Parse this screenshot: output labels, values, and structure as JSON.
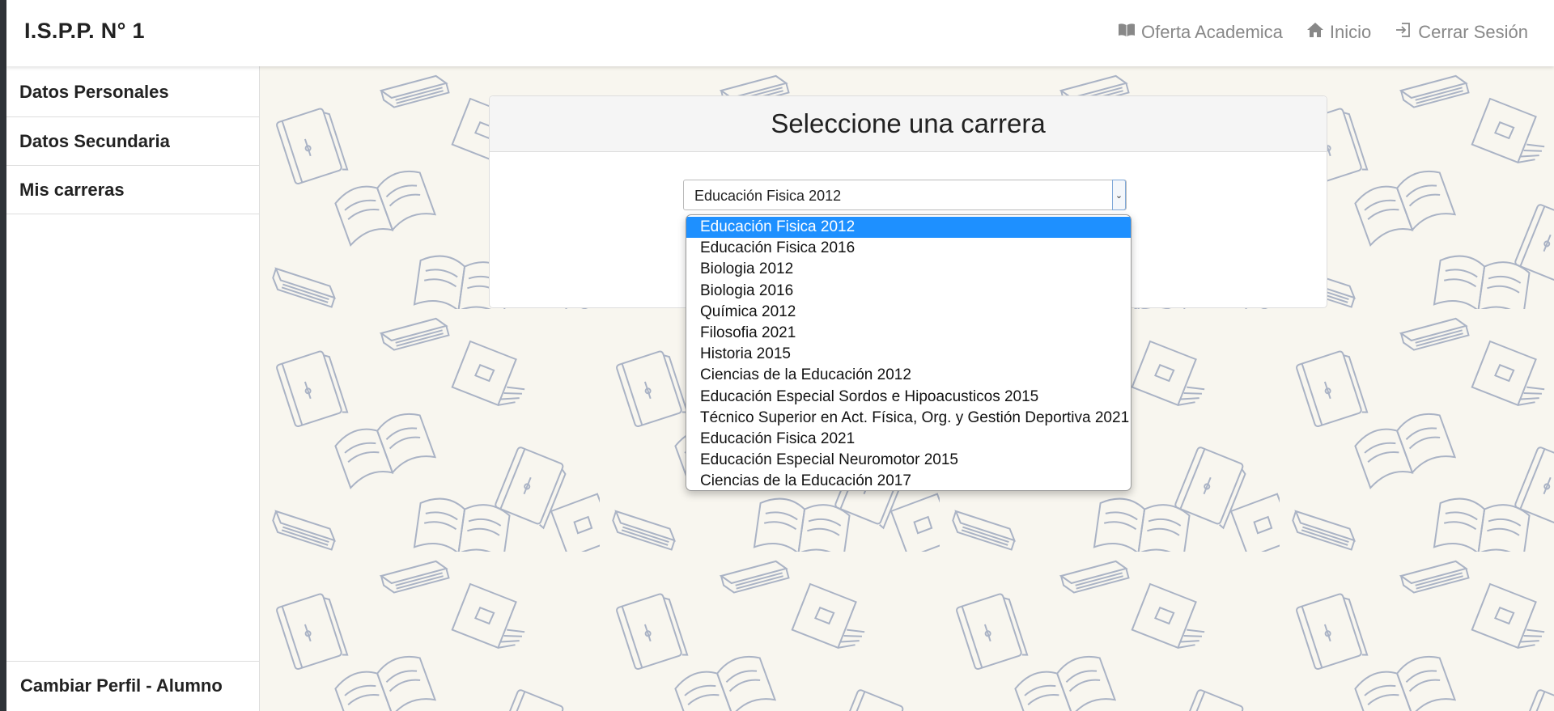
{
  "header": {
    "brand": "I.S.P.P. N° 1",
    "links": [
      {
        "label": "Oferta Academica",
        "icon": "book-icon"
      },
      {
        "label": "Inicio",
        "icon": "home-icon"
      },
      {
        "label": "Cerrar Sesión",
        "icon": "logout-icon"
      }
    ]
  },
  "sidebar": {
    "items": [
      {
        "label": "Datos Personales"
      },
      {
        "label": "Datos Secundaria"
      },
      {
        "label": "Mis carreras"
      }
    ],
    "bottom": "Cambiar Perfil - Alumno"
  },
  "card": {
    "title": "Seleccione una carrera",
    "select_value": "Educación Fisica 2012"
  },
  "dropdown": {
    "selected_index": 0,
    "options": [
      "Educación Fisica 2012",
      "Educación Fisica 2016",
      "Biologia 2012",
      "Biologia 2016",
      "Química 2012",
      "Filosofia 2021",
      "Historia 2015",
      "Ciencias de la Educación 2012",
      "Educación Especial Sordos e Hipoacusticos 2015",
      "Técnico Superior en Act. Física, Org. y Gestión Deportiva 2021",
      "Educación Fisica 2021",
      "Educación Especial Neuromotor 2015",
      "Ciencias de la Educación 2017"
    ]
  },
  "colors": {
    "selected_option": "#1e90ff",
    "background": "#f8f6ef",
    "pattern_stroke": "#aab3c5",
    "nav_link": "#888888"
  }
}
